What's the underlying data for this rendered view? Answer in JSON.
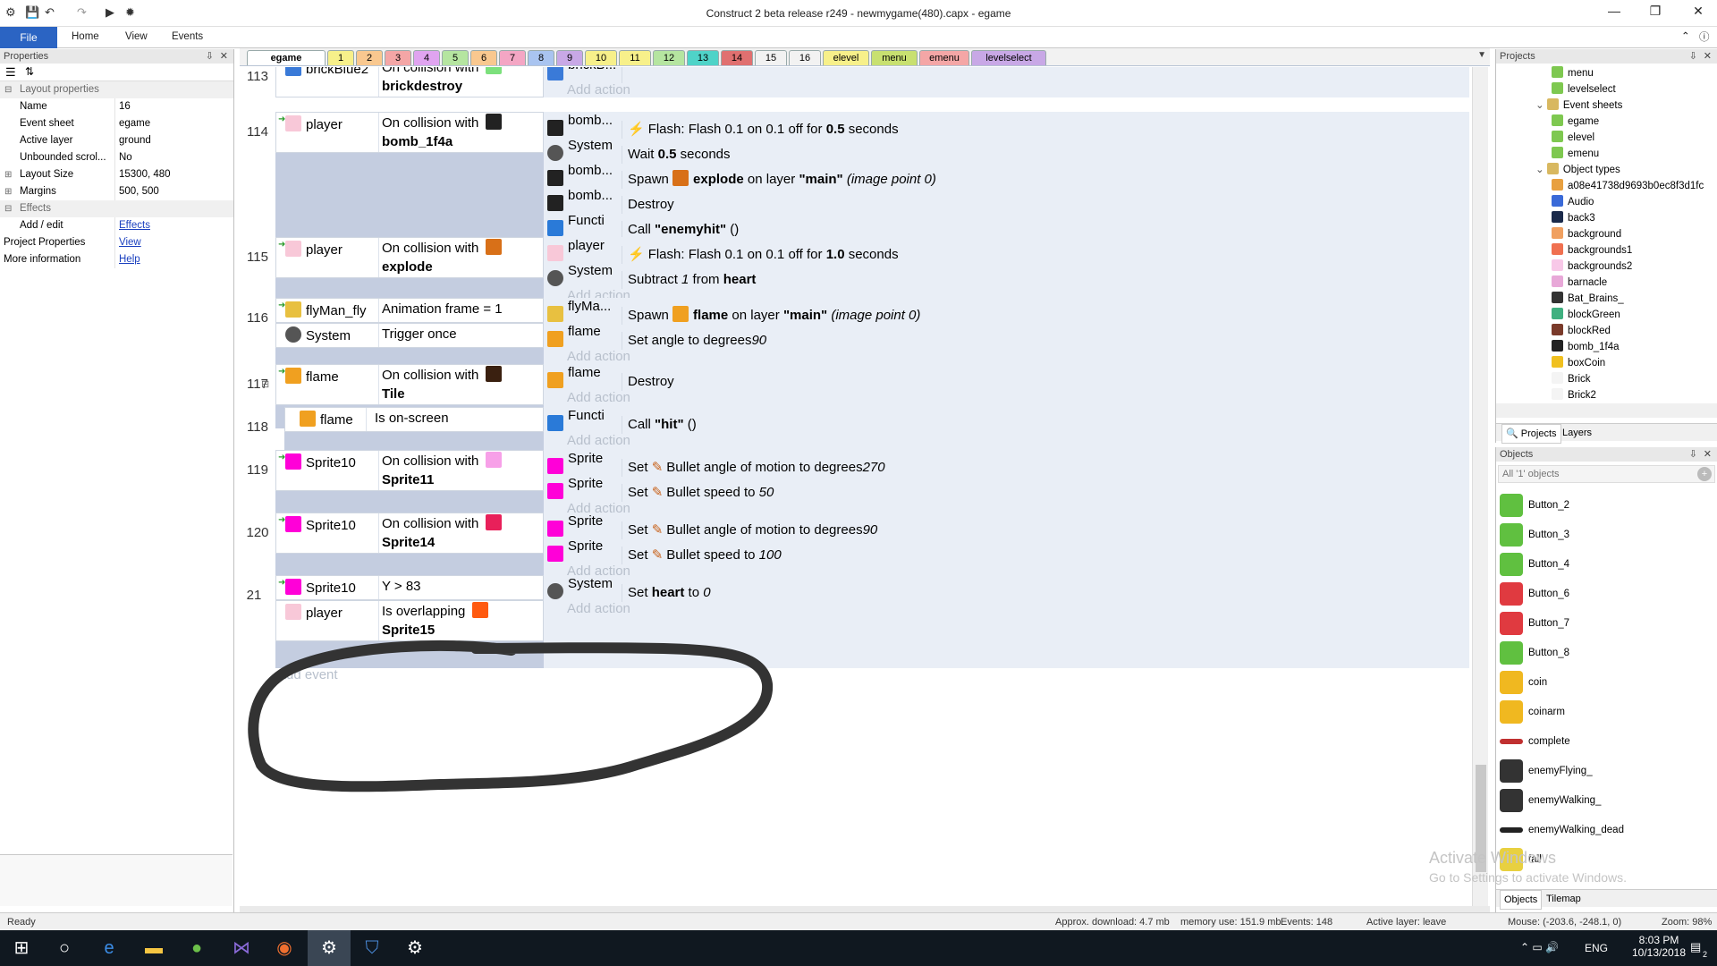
{
  "window": {
    "title": "Construct 2 beta release r249 - newmygame(480).capx - egame"
  },
  "ribbon": {
    "tabs": [
      "File",
      "Home",
      "View",
      "Events"
    ]
  },
  "properties": {
    "title": "Properties",
    "section_layout": "Layout properties",
    "rows": [
      {
        "key": "Name",
        "value": "16"
      },
      {
        "key": "Event sheet",
        "value": "egame"
      },
      {
        "key": "Active layer",
        "value": "ground"
      },
      {
        "key": "Unbounded scrol...",
        "value": "No"
      },
      {
        "key": "Layout Size",
        "value": "15300, 480"
      },
      {
        "key": "Margins",
        "value": "500, 500"
      }
    ],
    "section_effects": "Effects",
    "add_edit_key": "Add / edit",
    "add_edit_value": "Effects",
    "project_props_key": "Project Properties",
    "project_props_value": "View",
    "more_info_key": "More information",
    "more_info_value": "Help"
  },
  "sheet_tabs": [
    {
      "label": "egame",
      "color": "#ffffff"
    },
    {
      "label": "1",
      "color": "#f7f08a"
    },
    {
      "label": "2",
      "color": "#f9c88f"
    },
    {
      "label": "3",
      "color": "#f4a6a6"
    },
    {
      "label": "4",
      "color": "#e0a4f0"
    },
    {
      "label": "5",
      "color": "#b5e5a0"
    },
    {
      "label": "6",
      "color": "#f9c88f"
    },
    {
      "label": "7",
      "color": "#f4a6c4"
    },
    {
      "label": "8",
      "color": "#a9c4f0"
    },
    {
      "label": "9",
      "color": "#c8a8e6"
    },
    {
      "label": "10",
      "color": "#f7f08a"
    },
    {
      "label": "11",
      "color": "#f7f08a"
    },
    {
      "label": "12",
      "color": "#b5e5a0"
    },
    {
      "label": "13",
      "color": "#4fd3c8"
    },
    {
      "label": "14",
      "color": "#e07070"
    },
    {
      "label": "15",
      "color": "#f2f2f2"
    },
    {
      "label": "16",
      "color": "#f2f2f2"
    },
    {
      "label": "elevel",
      "color": "#f7f08a"
    },
    {
      "label": "menu",
      "color": "#c8e070"
    },
    {
      "label": "emenu",
      "color": "#f4a6a6"
    },
    {
      "label": "levelselect",
      "color": "#c8a8e6"
    }
  ],
  "events": [
    {
      "num": "113",
      "conds": [
        {
          "obj": "brickBlue2",
          "text": "On collision with",
          "bold": "brickdestroy"
        }
      ],
      "actions": [
        {
          "obj": "brickB...",
          "text": "Destroy"
        }
      ]
    },
    {
      "num": "114",
      "conds": [
        {
          "obj": "player",
          "text": "On collision with",
          "bold": "bomb_1f4a"
        }
      ],
      "actions": [
        {
          "obj": "bomb...",
          "pre": "Flash: Flash 0.1 on 0.1 off for ",
          "b": "0.5",
          "post": " seconds"
        },
        {
          "obj": "System",
          "pre": "Wait ",
          "b": "0.5",
          "post": " seconds"
        },
        {
          "obj": "bomb...",
          "pre": "Spawn ",
          "b": "explode",
          "post": " on layer ",
          "b2": "\"main\"",
          "it": " (image point 0)"
        },
        {
          "obj": "bomb...",
          "pre": "Destroy"
        },
        {
          "obj": "Functi",
          "pre": "Call ",
          "b": "\"enemyhit\"",
          "post": " ()"
        }
      ]
    },
    {
      "num": "115",
      "conds": [
        {
          "obj": "player",
          "text": "On collision with",
          "bold": "explode"
        }
      ],
      "actions": [
        {
          "obj": "player",
          "pre": "Flash: Flash 0.1 on 0.1 off for ",
          "b": "1.0",
          "post": " seconds"
        },
        {
          "obj": "System",
          "pre": "Subtract ",
          "it": "1",
          "post": " from ",
          "b": "heart"
        }
      ]
    },
    {
      "num": "116",
      "conds": [
        {
          "obj": "flyMan_fly",
          "text": "Animation frame = 1"
        },
        {
          "obj": "System",
          "text": "Trigger once"
        }
      ],
      "actions": [
        {
          "obj": "flyMa...",
          "pre": "Spawn ",
          "b": "flame",
          "post": " on layer ",
          "b2": "\"main\"",
          "it": " (image point 0)"
        },
        {
          "obj": "flame",
          "pre": "Set angle to ",
          "it": "90",
          "post": " degrees"
        }
      ]
    },
    {
      "num": "117",
      "conds": [
        {
          "obj": "flame",
          "text": "On collision with",
          "bold": "Tile"
        }
      ],
      "actions": [
        {
          "obj": "flame",
          "pre": "Destroy"
        }
      ]
    },
    {
      "num": "118",
      "conds": [
        {
          "obj": "flame",
          "text": "Is on-screen"
        }
      ],
      "actions": [
        {
          "obj": "Functi",
          "pre": "Call ",
          "b": "\"hit\"",
          "post": " ()"
        }
      ]
    },
    {
      "num": "119",
      "conds": [
        {
          "obj": "Sprite10",
          "text": "On collision with",
          "bold": "Sprite11"
        }
      ],
      "actions": [
        {
          "obj": "Sprite",
          "pre": "Set ",
          "mid": "Bullet angle of motion to ",
          "it": "270",
          "post": " degrees"
        },
        {
          "obj": "Sprite",
          "pre": "Set ",
          "mid": "Bullet speed to ",
          "it": "50"
        }
      ]
    },
    {
      "num": "120",
      "conds": [
        {
          "obj": "Sprite10",
          "text": "On collision with",
          "bold": "Sprite14"
        }
      ],
      "actions": [
        {
          "obj": "Sprite",
          "pre": "Set ",
          "mid": "Bullet angle of motion to ",
          "it": "90",
          "post": " degrees"
        },
        {
          "obj": "Sprite",
          "pre": "Set ",
          "mid": "Bullet speed to ",
          "it": "100"
        }
      ]
    },
    {
      "num": "21",
      "conds": [
        {
          "obj": "Sprite10",
          "text": "Y > 83"
        },
        {
          "obj": "player",
          "text": "Is overlapping",
          "bold": "Sprite15"
        }
      ],
      "actions": [
        {
          "obj": "System",
          "pre": "Set ",
          "b": "heart",
          "post": " to ",
          "it": "0"
        }
      ]
    }
  ],
  "add_action": "Add action",
  "add_event": "Add event",
  "projects_panel": {
    "title": "Projects",
    "items": [
      "menu",
      "levelselect",
      "Event sheets",
      "egame",
      "elevel",
      "emenu",
      "Object types",
      "a08e41738d9693b0ec8f3d1fc",
      "Audio",
      "back3",
      "background",
      "backgrounds1",
      "backgrounds2",
      "barnacle",
      "Bat_Brains_",
      "blockGreen",
      "blockRed",
      "bomb_1f4a",
      "boxCoin",
      "Brick",
      "Brick2"
    ],
    "tab_projects": "Projects",
    "tab_layers": "Layers"
  },
  "objects_panel": {
    "title": "Objects",
    "filter_placeholder": "All '1' objects",
    "items": [
      "Button_2",
      "Button_3",
      "Button_4",
      "Button_6",
      "Button_7",
      "Button_8",
      "coin",
      "coinarm",
      "complete",
      "enemyFlying_",
      "enemyWalking_",
      "enemyWalking_dead",
      "fall"
    ],
    "tab_objects": "Objects",
    "tab_tilemap": "Tilemap"
  },
  "watermark": {
    "line1": "Activate Windows",
    "line2": "Go to Settings to activate Windows."
  },
  "statusbar": {
    "ready": "Ready",
    "download": "Approx. download: 4.7 mb",
    "memory": "memory use: 151.9 mb",
    "events": "Events: 148",
    "active_layer": "Active layer: leave",
    "mouse": "Mouse: (-203.6, -248.1, 0)",
    "zoom": "Zoom: 98%"
  },
  "taskbar": {
    "lang": "ENG",
    "time": "8:03 PM",
    "date": "10/13/2018",
    "notif": "2"
  }
}
